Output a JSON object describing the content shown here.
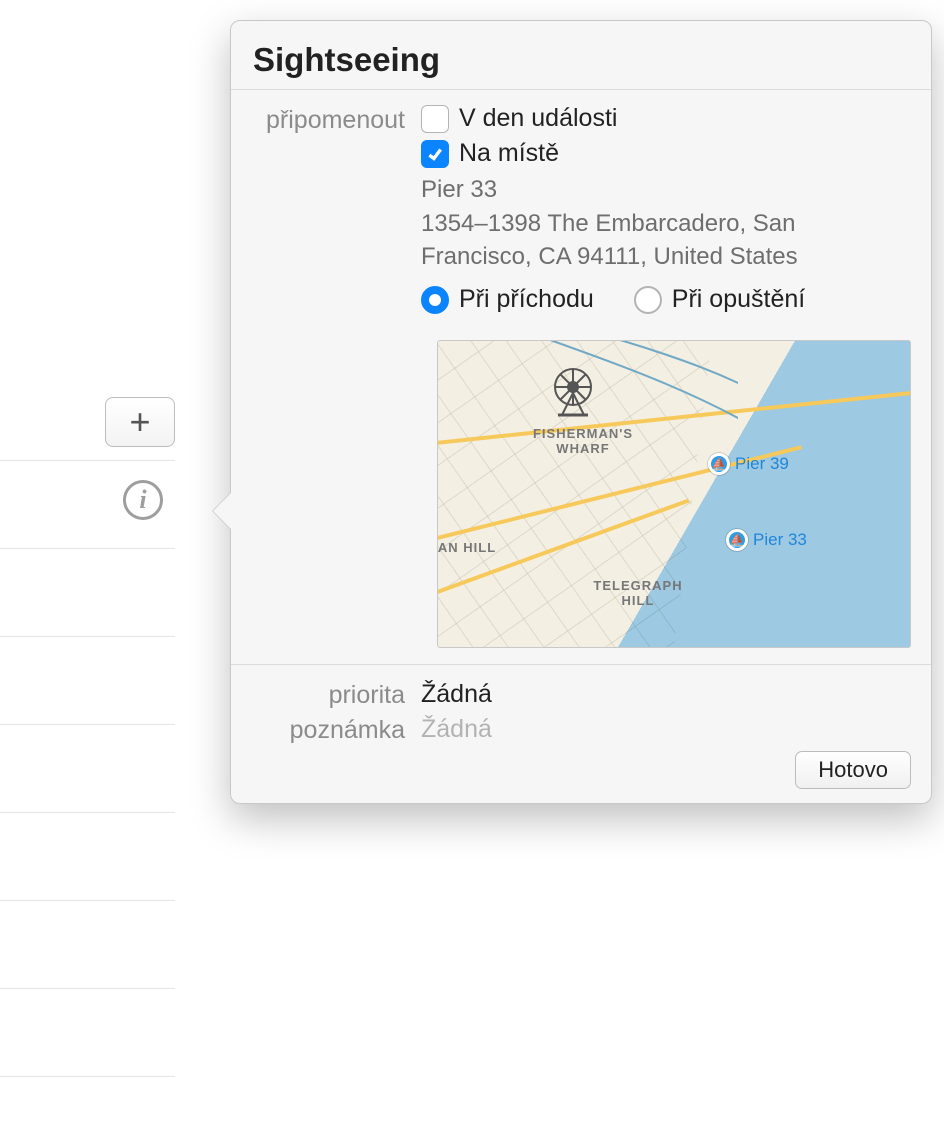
{
  "popover": {
    "title": "Sightseeing",
    "remind_label": "připomenout",
    "on_day_label": "V den události",
    "on_day_checked": false,
    "at_location_label": "Na místě",
    "at_location_checked": true,
    "location_name": "Pier 33",
    "location_address": "1354–1398 The Embarcadero, San Francisco, CA  94111, United States",
    "arrive_label": "Při příchodu",
    "leave_label": "Při opuštění",
    "location_trigger": "arrive",
    "priority_label": "priorita",
    "priority_value": "Žádná",
    "note_label": "poznámka",
    "note_placeholder": "Žádná",
    "done_label": "Hotovo"
  },
  "map": {
    "districts": {
      "fishermans_wharf": "FISHERMAN'S WHARF",
      "an_hill": "AN HILL",
      "telegraph_hill": "TELEGRAPH HILL"
    },
    "pois": {
      "pier39": "Pier 39",
      "pier33": "Pier 33"
    }
  }
}
